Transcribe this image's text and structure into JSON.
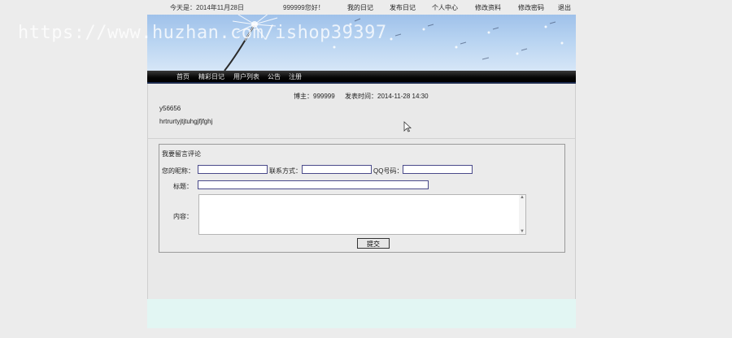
{
  "topbar": {
    "date": "今天是：2014年11月28日",
    "greeting": "999999您好！",
    "links": [
      "我的日记",
      "发布日记",
      "个人中心",
      "修改资料",
      "修改密码",
      "退出"
    ]
  },
  "watermark": "https://www.huzhan.com/ishop39397",
  "nav": [
    "首页",
    "精彩日记",
    "用户列表",
    "公告",
    "注册"
  ],
  "post": {
    "author": "博主：999999",
    "time": "发表时间：2014-11-28 14:30",
    "title": "y56656",
    "content": "hrtrurtyjtjtuhgjfjfghj"
  },
  "form": {
    "heading": "我要留言评论",
    "nickname_label": "您的昵称：",
    "contact_label": "联系方式：",
    "qq_label": "QQ号码：",
    "subject_label": "标题：",
    "content_label": "内容：",
    "submit_label": "提交"
  },
  "colors": {
    "nav_bg": "#000000",
    "footer_bg": "#e2f6f3",
    "input_border": "#4a4a8a"
  }
}
